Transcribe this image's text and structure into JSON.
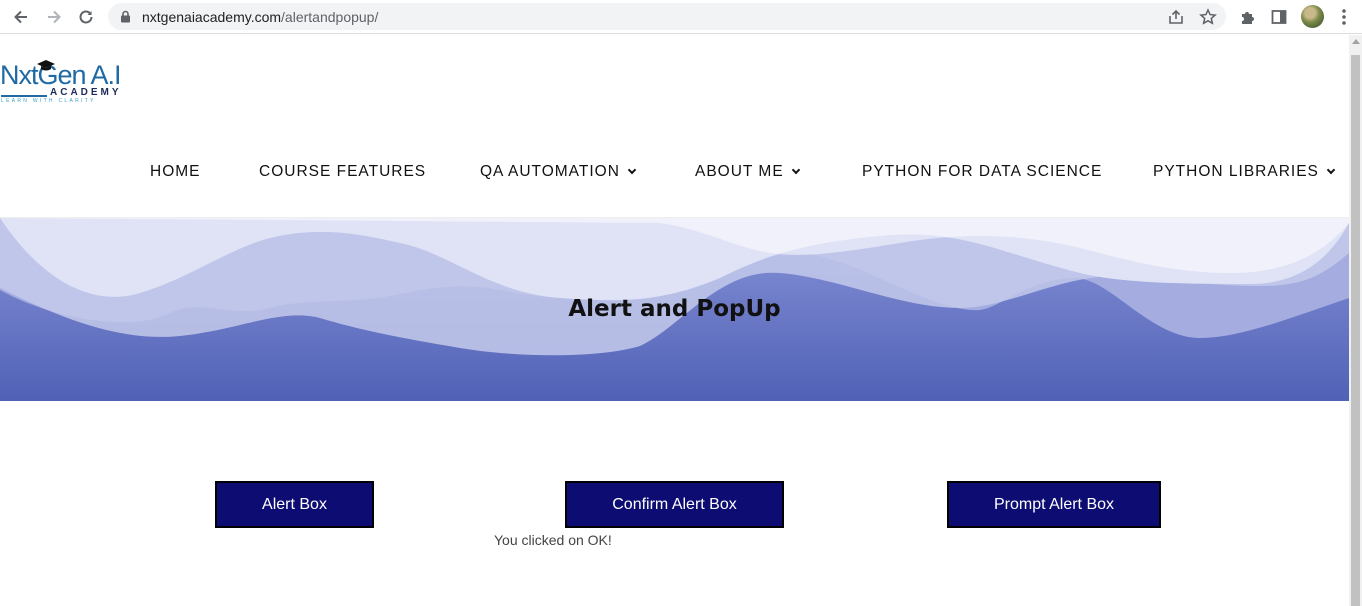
{
  "browser": {
    "url_domain": "nxtgenaiacademy.com",
    "url_path": "/alertandpopup/",
    "icons": [
      "back-icon",
      "forward-icon",
      "reload-icon",
      "lock-icon",
      "share-icon",
      "star-icon",
      "extensions-icon",
      "side-panel-icon",
      "profile-avatar",
      "menu-icon"
    ]
  },
  "logo": {
    "main": "NxtGen A.I",
    "academy": "ACADEMY",
    "tagline": "LEARN WITH CLARITY"
  },
  "nav": {
    "items": [
      {
        "label": "HOME",
        "has_dropdown": false
      },
      {
        "label": "COURSE FEATURES",
        "has_dropdown": false
      },
      {
        "label": "QA AUTOMATION",
        "has_dropdown": true
      },
      {
        "label": "ABOUT ME",
        "has_dropdown": true
      },
      {
        "label": "PYTHON FOR DATA SCIENCE",
        "has_dropdown": false
      },
      {
        "label": "PYTHON LIBRARIES",
        "has_dropdown": true
      }
    ]
  },
  "hero": {
    "title": "Alert and PopUp"
  },
  "main": {
    "buttons": [
      {
        "label": "Alert Box"
      },
      {
        "label": "Confirm Alert Box"
      },
      {
        "label": "Prompt Alert Box"
      }
    ],
    "result_text": "You clicked on OK!"
  },
  "colors": {
    "button_bg": "#0c0c73",
    "hero_dark": "#5566bb",
    "hero_light": "#dde2f5"
  }
}
